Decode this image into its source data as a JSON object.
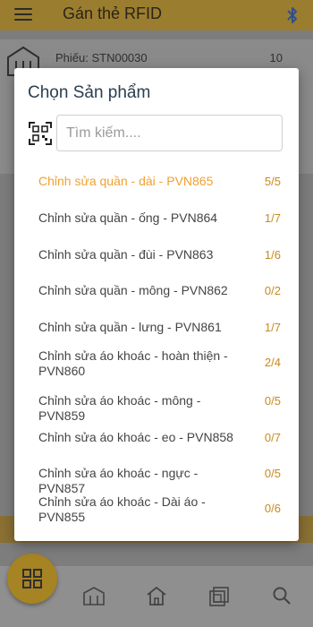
{
  "header": {
    "title": "Gán thẻ RFID",
    "menu_icon": "menu-icon",
    "bluetooth_icon": "bluetooth-icon"
  },
  "background": {
    "ticket_label": "Phiếu: STN00030",
    "ticket_count": "10"
  },
  "modal": {
    "title": "Chọn Sản phẩm",
    "search_placeholder": "Tìm kiếm....",
    "search_value": "",
    "scan_icon": "qr-scan-icon",
    "accent_color": "#f0a030",
    "count_color": "#c9891c",
    "items": [
      {
        "name": "Chỉnh sửa quần - dài - PVN865",
        "count": "5/5",
        "selected": true
      },
      {
        "name": "Chỉnh sửa quần - ống - PVN864",
        "count": "1/7"
      },
      {
        "name": "Chỉnh sửa quần - đùi - PVN863",
        "count": "1/6"
      },
      {
        "name": "Chỉnh sửa quần - mông - PVN862",
        "count": "0/2"
      },
      {
        "name": "Chỉnh sửa quần - lưng - PVN861",
        "count": "1/7"
      },
      {
        "name": "Chỉnh sửa áo khoác - hoàn thiện - PVN860",
        "count": "2/4"
      },
      {
        "name": "Chỉnh sửa áo khoác - mông - PVN859",
        "count": "0/5"
      },
      {
        "name": "Chỉnh sửa áo khoác - eo - PVN858",
        "count": "0/7"
      },
      {
        "name": "Chỉnh sửa áo khoác - ngực - PVN857",
        "count": "0/5"
      },
      {
        "name": "Chỉnh sửa áo khoác - Dài áo - PVN855",
        "count": "0/6"
      }
    ]
  },
  "bottom_nav": {
    "fab_icon": "grid-icon",
    "items": [
      "warehouse-icon",
      "home-icon",
      "layers-icon",
      "search-icon"
    ]
  }
}
